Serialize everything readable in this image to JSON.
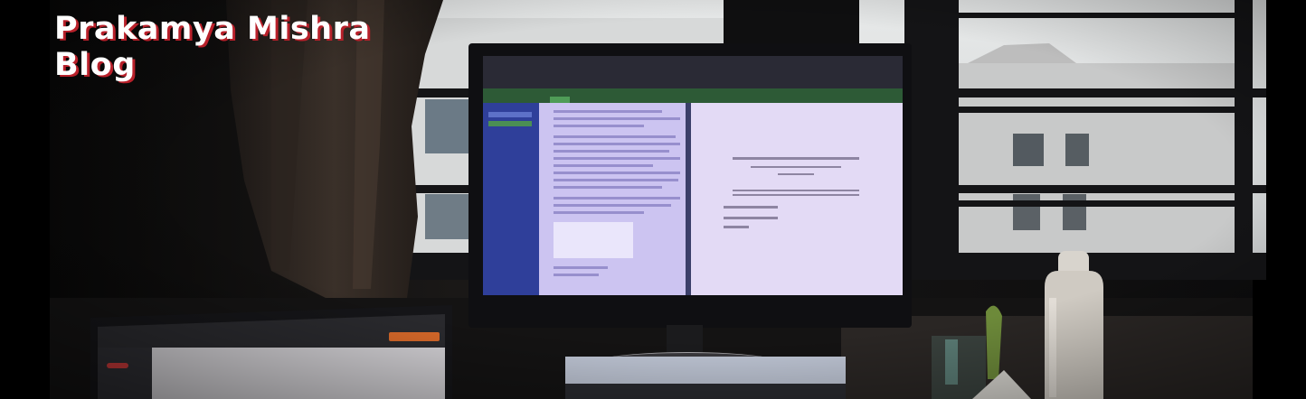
{
  "header": {
    "title_line1": "Prakamya Mishra",
    "title_line2": "Blog"
  },
  "colors": {
    "title_text": "#ffffff",
    "title_shadow": "#b8202a",
    "room_dark": "#0b0b0c",
    "monitor_screen": "#cfc6ee",
    "window_light": "#d9dbdc"
  }
}
